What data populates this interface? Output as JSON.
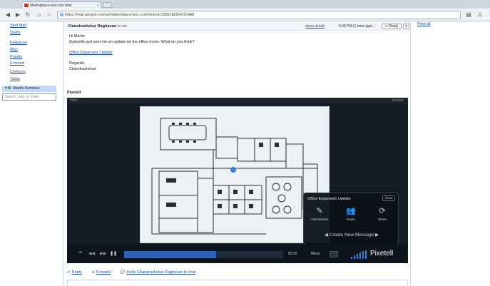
{
  "browser": {
    "tab_title": "Marketplace-test.com Mail",
    "url": "https://mail.google.com/a/marketplace-test.com/#inbox/1289cfb05e03c4d8"
  },
  "left_nav": {
    "links": [
      {
        "label": "Sent Mail"
      },
      {
        "label": "Drafts"
      },
      {
        "label": "Follow up"
      },
      {
        "label": "Misc"
      },
      {
        "label": "Priority"
      },
      {
        "label": "6 more▾"
      },
      {
        "label": "Contacts"
      },
      {
        "label": "Tasks"
      }
    ],
    "chat_user": "Martin Kemnou",
    "chat_search_placeholder": "Search, add, or invite"
  },
  "right_col": {
    "link": "Print all"
  },
  "message": {
    "sender": "Chandrashekar Raghavan",
    "to": "to me",
    "show_details": "show details",
    "time": "6:40 PM (1 hour ago)",
    "reply_label": "Reply",
    "greeting": "Hi Martin",
    "line1": "Gabrielle just sent me an update on the office move. What do you think?",
    "link": "Office Expansion Update",
    "sign1": "Regards,",
    "sign2": "Chandrashekar",
    "attachment_title": "Pixetell"
  },
  "player": {
    "top_left": "Hide",
    "top_right": "Smaller",
    "timecode": "00:30",
    "menu": "Menu",
    "brand": "Pixetell",
    "progress": 0.58,
    "popup": {
      "title": "Office Expansion Update",
      "close": "close",
      "items": [
        {
          "icon": "paperclip-icon",
          "label": "Attachments"
        },
        {
          "icon": "people-icon",
          "label": "Reply"
        },
        {
          "icon": "share-icon",
          "label": "Share"
        }
      ],
      "create": "Create New Message"
    }
  },
  "actions": {
    "reply": "Reply",
    "forward": "Forward",
    "chat": "Invite Chandrashekar Raghavan to chat"
  }
}
